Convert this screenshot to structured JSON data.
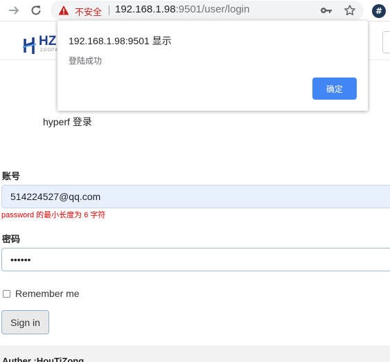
{
  "browser": {
    "insecure_label": "不安全",
    "url_host": "192.168.1.98",
    "url_rest": ":9501/user/login",
    "extension_label": "#"
  },
  "header": {
    "logo_text": "HZ",
    "logo_sub": "ZOOPX"
  },
  "page": {
    "title": "hyperf 登录",
    "account_label": "账号",
    "account_value": "514224527@qq.com",
    "error_text": "password 的最小长度为 6 字符",
    "password_label": "密码",
    "password_value": "••••••",
    "remember_label": "Remember me",
    "remember_checked": false,
    "signin_label": "Sign in",
    "footer_text": "Auther :HouTiZong"
  },
  "dialog": {
    "title": "192.168.1.98:9501 显示",
    "message": "登陆成功",
    "ok_label": "确定"
  },
  "colors": {
    "insecure": "#c5221f",
    "error": "#e00000",
    "dialog_button": "#4285f4",
    "autofill_bg": "#e8f0fe"
  }
}
